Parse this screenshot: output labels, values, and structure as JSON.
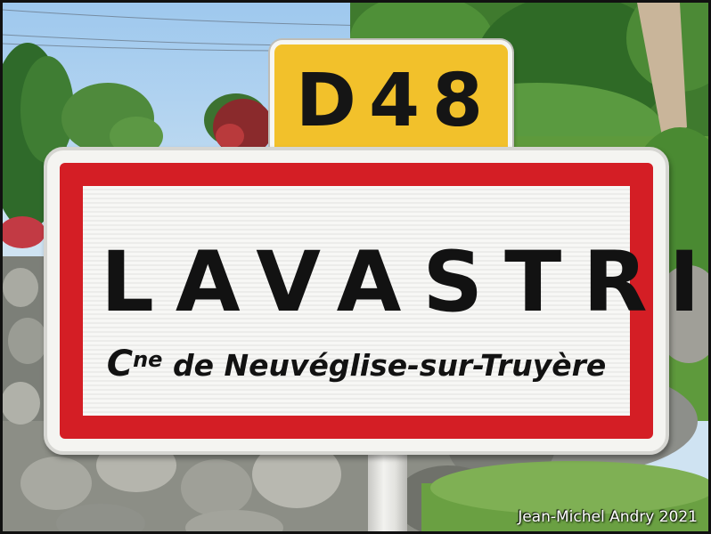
{
  "route_sign": {
    "number": "D48",
    "color": "#f2c12b"
  },
  "town_sign": {
    "name": "LAVASTRIE",
    "commune_prefix": "C",
    "commune_prefix_sup": "ne",
    "commune_rest": " de Neuvéglise-sur-Truyère",
    "border_color": "#d41e25"
  },
  "credit": "Jean-Michel Andry 2021"
}
